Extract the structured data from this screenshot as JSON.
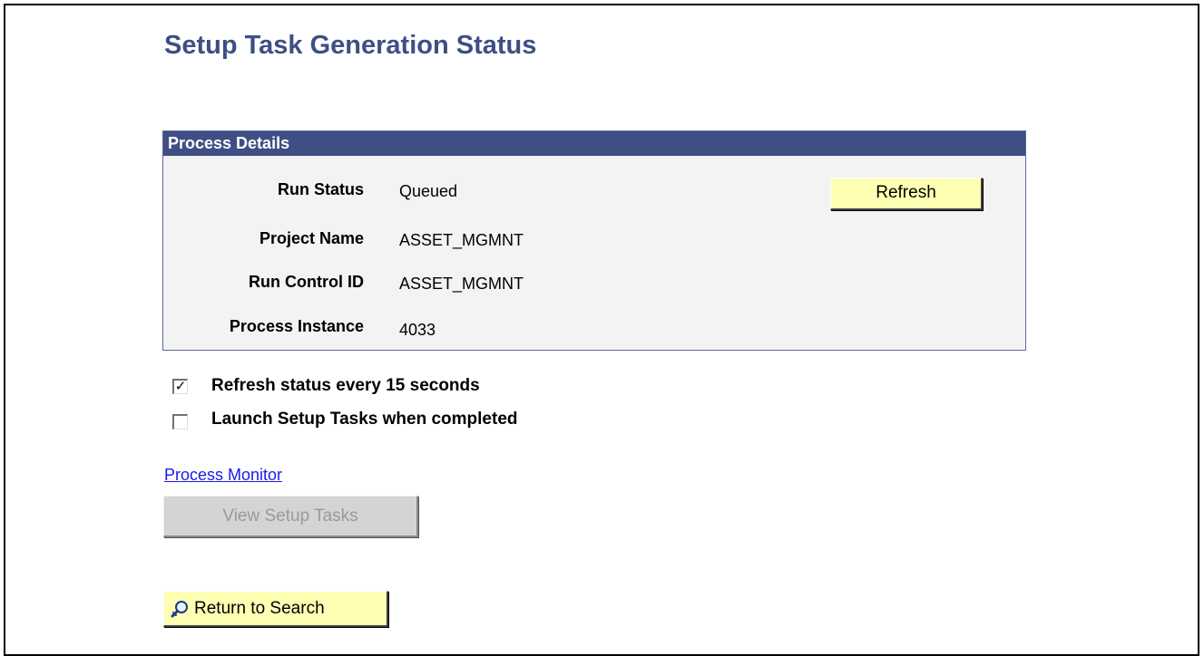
{
  "page": {
    "title": "Setup Task Generation Status"
  },
  "process_details": {
    "header": "Process Details",
    "fields": [
      {
        "label": "Run Status",
        "value": "Queued"
      },
      {
        "label": "Project Name",
        "value": "ASSET_MGMNT"
      },
      {
        "label": "Run Control ID",
        "value": "ASSET_MGMNT"
      },
      {
        "label": "Process Instance",
        "value": "4033"
      }
    ],
    "refresh_label": "Refresh"
  },
  "options": {
    "refresh_every": {
      "label": "Refresh status every 15 seconds",
      "checked": true
    },
    "launch_when_completed": {
      "label": "Launch Setup Tasks when completed",
      "checked": false
    }
  },
  "links": {
    "process_monitor": "Process Monitor"
  },
  "buttons": {
    "view_setup_tasks": "View Setup Tasks",
    "return_to_search": "Return to Search"
  },
  "icons": {
    "search_icon": "search-icon"
  },
  "colors": {
    "title": "#3d4f84",
    "header_bg": "#3f4f85",
    "button_yellow": "#ffffb3",
    "link": "#1a1aee",
    "disabled_button": "#d4d4d4"
  }
}
